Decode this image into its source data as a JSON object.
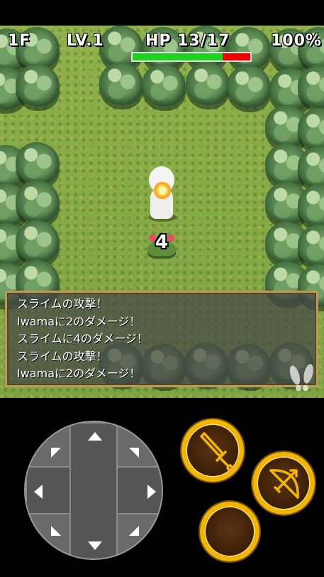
{
  "hud": {
    "floor": "1F",
    "level": "LV.1",
    "hp_label": "HP",
    "hp_value": "13/17",
    "hp_current": 13,
    "hp_max": 17,
    "fullness": "100%"
  },
  "battle": {
    "damage_popup": "4"
  },
  "message_log": [
    "スライムの攻撃！",
    "Iwamaに2のダメージ！",
    "スライムに4のダメージ！",
    "スライムの攻撃！",
    "Iwamaに2のダメージ！"
  ],
  "icons": {
    "footsteps": "footsteps-icon",
    "dpad": "dpad",
    "attack": "sword-icon",
    "shoot": "bow-icon"
  },
  "colors": {
    "hp_fill": "#1fd21f",
    "hp_empty": "#ee0000",
    "button_ring": "#f2b500",
    "grass": "#86a848",
    "log_border": "#b89a5a"
  }
}
